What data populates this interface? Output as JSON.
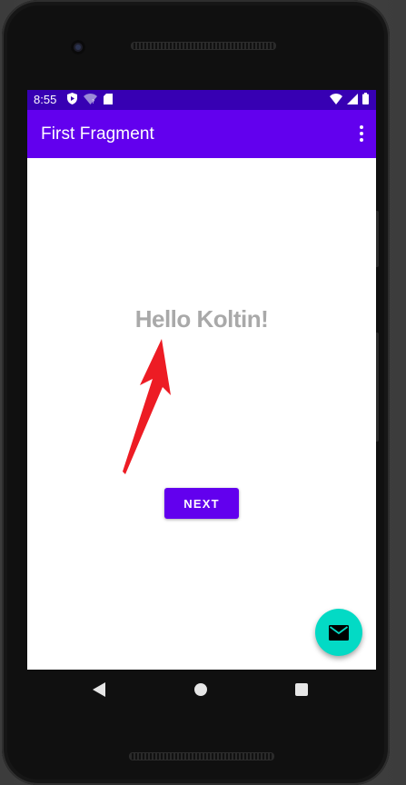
{
  "status_bar": {
    "time": "8:55",
    "icons_left": [
      "play-protect-icon",
      "wifi-question-icon",
      "sd-card-icon"
    ],
    "icons_right": [
      "wifi-icon",
      "signal-icon",
      "battery-icon"
    ],
    "bg_color": "#3700b3"
  },
  "app_bar": {
    "title": "First Fragment",
    "bg_color": "#6200ee",
    "overflow_icon": "more-vert-icon"
  },
  "content": {
    "hello_text": "Hello Koltin!",
    "next_button_label": "NEXT",
    "annotation": "red-arrow-pointing-to-text"
  },
  "fab": {
    "icon": "email-icon",
    "color": "#03dac5"
  },
  "nav_bar": {
    "buttons": [
      "back-icon",
      "home-icon",
      "recents-icon"
    ]
  }
}
